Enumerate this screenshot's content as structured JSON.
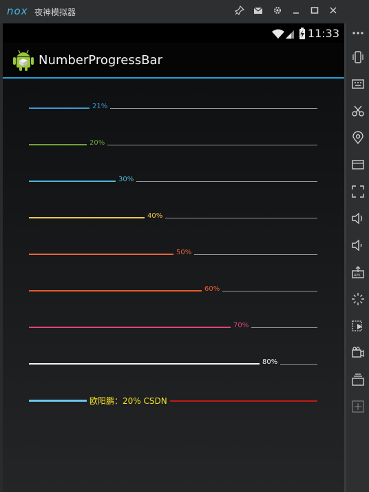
{
  "window": {
    "logo": "nox",
    "title": "夜神模拟器",
    "controls": [
      "pin-icon",
      "mail-icon",
      "gear-icon",
      "minimize-icon",
      "maximize-icon",
      "close-icon"
    ]
  },
  "statusbar": {
    "time": "11:33"
  },
  "app": {
    "title": "NumberProgressBar"
  },
  "progress_bars": [
    {
      "label": "21%",
      "value": 0.21,
      "color": "#3d9ad6"
    },
    {
      "label": "20%",
      "value": 0.2,
      "color": "#6fa23a"
    },
    {
      "label": "30%",
      "value": 0.3,
      "color": "#4fb8de"
    },
    {
      "label": "40%",
      "value": 0.4,
      "color": "#f3c74f"
    },
    {
      "label": "50%",
      "value": 0.5,
      "color": "#e8663c"
    },
    {
      "label": "60%",
      "value": 0.6,
      "color": "#ef5a2a"
    },
    {
      "label": "70%",
      "value": 0.7,
      "color": "#e2447a"
    },
    {
      "label": "80%",
      "value": 0.8,
      "color": "#f5f5f5"
    },
    {
      "label": "欧阳鹏：20%  CSDN",
      "value": 0.2,
      "color": "#6ec6ee",
      "text_color": "#f2e325",
      "unreached_color": "#c01818"
    }
  ],
  "sidebar_icons": [
    "more-icon",
    "rotate-phone-icon",
    "keyboard-icon",
    "screenshot-scissors-icon",
    "location-icon",
    "screen-icon",
    "fullscreen-icon",
    "volume-up-icon",
    "volume-down-icon",
    "apk-install-icon",
    "loading-icon",
    "shake-icon",
    "video-record-icon",
    "multi-instance-icon",
    "add-icon"
  ]
}
